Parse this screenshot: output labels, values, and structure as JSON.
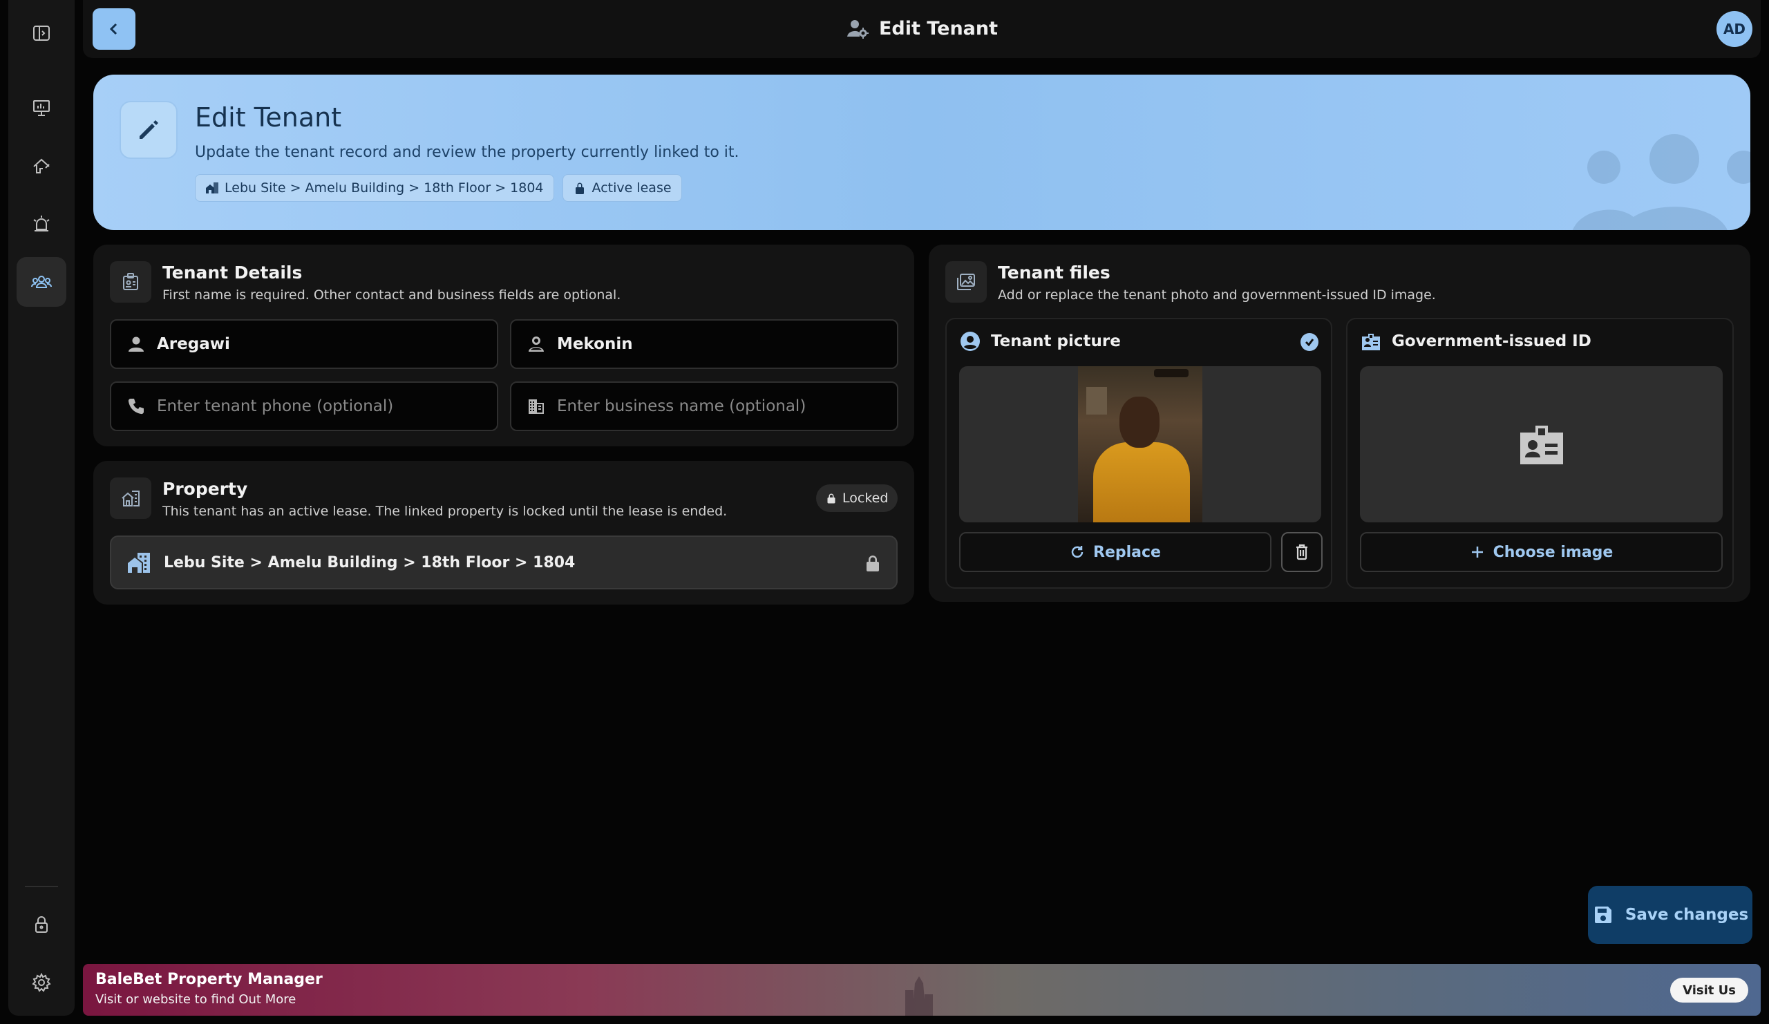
{
  "header": {
    "title": "Edit Tenant",
    "avatar_initials": "AD"
  },
  "hero": {
    "title": "Edit Tenant",
    "subtitle": "Update the tenant record and review the property currently linked to it.",
    "location_chip": "Lebu Site > Amelu Building > 18th Floor > 1804",
    "status_chip": "Active lease"
  },
  "tenant_details": {
    "title": "Tenant Details",
    "subtitle": "First name is required. Other contact and business fields are optional.",
    "first_name": "Aregawi",
    "last_name": "Mekonin",
    "phone_placeholder": "Enter tenant phone (optional)",
    "business_placeholder": "Enter business name (optional)"
  },
  "property": {
    "title": "Property",
    "subtitle": "This tenant has an active lease. The linked property is locked until the lease is ended.",
    "badge": "Locked",
    "path": "Lebu Site > Amelu Building > 18th Floor > 1804"
  },
  "tenant_files": {
    "title": "Tenant files",
    "subtitle": "Add or replace the tenant photo and government-issued ID image.",
    "picture_label": "Tenant picture",
    "replace_label": "Replace",
    "id_label": "Government-issued ID",
    "choose_label": "Choose image"
  },
  "save_label": "Save changes",
  "footer": {
    "title": "BaleBet Property Manager",
    "subtitle": "Visit or website to find Out More",
    "visit_label": "Visit Us"
  },
  "colors": {
    "accent": "#8fc2f3",
    "save_bg": "#0f3d66",
    "background": "#050505"
  },
  "icons": {
    "sidebar": [
      "sidebar-toggle-icon",
      "presentation-icon",
      "home-icon",
      "alarm-icon",
      "users-icon",
      "lock-icon",
      "gear-icon"
    ]
  }
}
